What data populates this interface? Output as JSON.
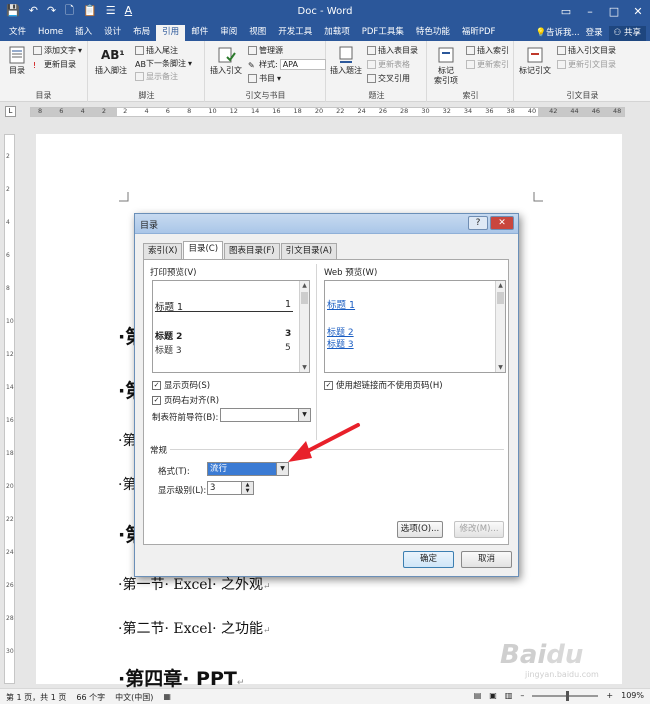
{
  "titlebar": {
    "title": "Doc - Word",
    "quick_access": [
      "save-icon",
      "undo-icon",
      "redo-icon",
      "new-doc-icon",
      "paste-icon",
      "format-icon",
      "font-color-icon"
    ]
  },
  "tabs": [
    "文件",
    "Home",
    "插入",
    "设计",
    "布局",
    "引用",
    "邮件",
    "审阅",
    "视图",
    "开发工具",
    "加载项",
    "PDF工具集",
    "特色功能",
    "福昕PDF"
  ],
  "tab_active": "引用",
  "tell_me": "告诉我...",
  "signin": "登录",
  "share": "共享",
  "ribbon": {
    "toc_group": {
      "label": "目录",
      "toc_btn": "目录",
      "add_text": "添加文字",
      "update_toc": "更新目录"
    },
    "footnote_group": {
      "label": "脚注",
      "insert_footnote": "插入脚注",
      "insert_endnote": "插入尾注",
      "next_footnote": "下一条脚注",
      "show_notes": "显示备注"
    },
    "citation_group": {
      "label": "引文与书目",
      "insert_citation": "插入引文",
      "manage_sources": "管理源",
      "style_label": "样式:",
      "style_value": "APA",
      "bibliography": "书目"
    },
    "caption_group": {
      "label": "题注",
      "insert_caption": "插入题注",
      "insert_tof": "插入表目录",
      "update_table": "更新表格",
      "cross_ref": "交叉引用"
    },
    "index_group": {
      "label": "索引",
      "mark_entry": "标记\n索引项",
      "insert_index": "插入索引",
      "update_index": "更新索引"
    },
    "toa_group": {
      "label": "引文目录",
      "mark_citation": "标记引文",
      "insert_toa": "插入引文目录",
      "update_toa": "更新引文目录"
    }
  },
  "ruler": [
    "8",
    "6",
    "4",
    "2",
    "2",
    "4",
    "6",
    "8",
    "10",
    "12",
    "14",
    "16",
    "18",
    "20",
    "22",
    "24",
    "26",
    "28",
    "30",
    "32",
    "34",
    "36",
    "38",
    "40",
    "42",
    "44",
    "46",
    "48"
  ],
  "vruler": [
    "2",
    "2",
    "4",
    "6",
    "8",
    "10",
    "12",
    "14",
    "16",
    "18",
    "20",
    "22",
    "24",
    "26",
    "28",
    "30"
  ],
  "document": {
    "lines": [
      {
        "text": "第二章 Word",
        "cls": "h1",
        "visible": "第"
      },
      {
        "text": "第",
        "cls": "h1"
      },
      {
        "text": "第",
        "cls": "h2"
      },
      {
        "text": "第",
        "cls": "h2"
      },
      {
        "text": "第",
        "cls": "h1"
      },
      {
        "text": "第一节· Excel· 之外观",
        "cls": "h2"
      },
      {
        "text": "第二节· Excel· 之功能",
        "cls": "h2"
      },
      {
        "text": "第四章· PPT",
        "cls": "h1"
      }
    ],
    "para_mark": "↵"
  },
  "dialog": {
    "title": "目录",
    "help": "?",
    "close": "✕",
    "tabs": [
      "索引(X)",
      "目录(C)",
      "图表目录(F)",
      "引文目录(A)"
    ],
    "active_tab": "目录(C)",
    "print_preview_label": "打印预览(V)",
    "web_preview_label": "Web 预览(W)",
    "print_preview": [
      {
        "text": "标题 1",
        "num": "1",
        "level": 1
      },
      {
        "text": "标题 2",
        "num": "3",
        "level": 2
      },
      {
        "text": "标题 3",
        "num": "5",
        "level": 3
      }
    ],
    "web_preview": [
      "标题 1",
      "标题 2",
      "标题 3"
    ],
    "show_page_numbers": "显示页码(S)",
    "right_align": "页码右对齐(R)",
    "tab_leader_label": "制表符前导符(B):",
    "tab_leader_value": "",
    "use_hyperlinks": "使用超链接而不使用页码(H)",
    "general_label": "常规",
    "format_label": "格式(T):",
    "format_value": "流行",
    "levels_label": "显示级别(L):",
    "levels_value": "3",
    "options_btn": "选项(O)...",
    "modify_btn": "修改(M)...",
    "ok_btn": "确定",
    "cancel_btn": "取消"
  },
  "status": {
    "page": "第 1 页，共 1 页",
    "words": "66 个字",
    "lang": "中文(中国)",
    "zoom": "109%"
  },
  "watermark": {
    "text": "Bai du 经验",
    "url": "jingyan.baidu.com"
  },
  "colors": {
    "accent": "#2b579a",
    "arrow": "#e8202a",
    "selection": "#3b7bd4"
  }
}
